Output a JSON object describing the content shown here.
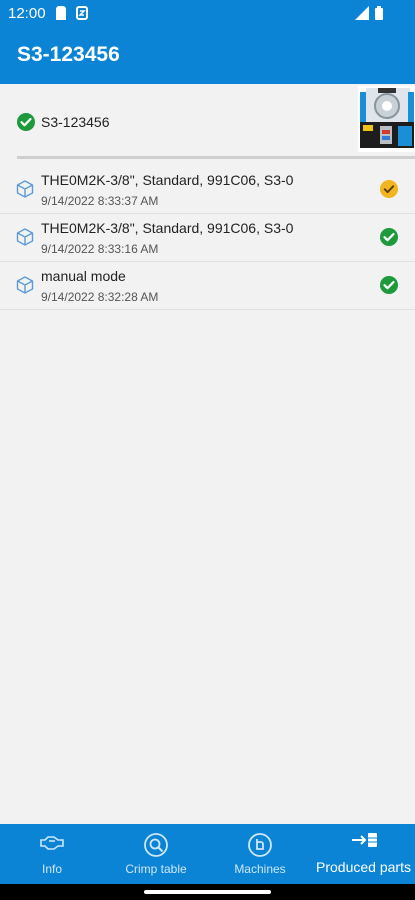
{
  "status_bar": {
    "time": "12:00"
  },
  "app_bar": {
    "title": "S3-123456"
  },
  "machine": {
    "name": "S3-123456"
  },
  "parts": [
    {
      "title": "THE0M2K-3/8\", Standard, 991C06, S3-0",
      "time": "9/14/2022 8:33:37 AM",
      "status": "warning"
    },
    {
      "title": "THE0M2K-3/8\", Standard, 991C06, S3-0",
      "time": "9/14/2022 8:33:16 AM",
      "status": "ok"
    },
    {
      "title": "manual mode",
      "time": "9/14/2022 8:32:28 AM",
      "status": "ok"
    }
  ],
  "bottom_nav": {
    "items": [
      {
        "label": "Info",
        "icon": "info-icon"
      },
      {
        "label": "Crimp table",
        "icon": "search-icon"
      },
      {
        "label": "Machines",
        "icon": "machine-icon"
      },
      {
        "label": "Produced parts",
        "icon": "produced-parts-icon",
        "active": true
      }
    ]
  },
  "colors": {
    "primary": "#0b84d6",
    "ok": "#1e9a3c",
    "warning": "#f2b51f"
  }
}
